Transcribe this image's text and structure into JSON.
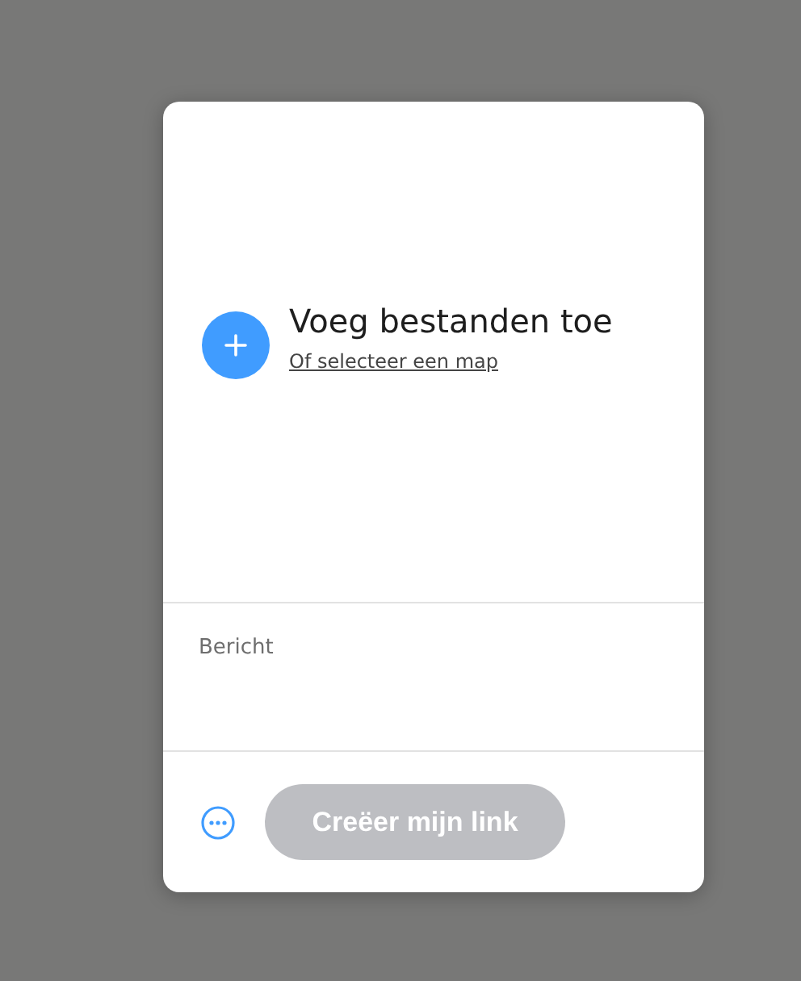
{
  "upload": {
    "title": "Voeg bestanden toe",
    "link": "Of selecteer een map"
  },
  "message": {
    "placeholder": "Bericht"
  },
  "create_button": {
    "label": "Creëer mijn link",
    "disabled": true
  }
}
